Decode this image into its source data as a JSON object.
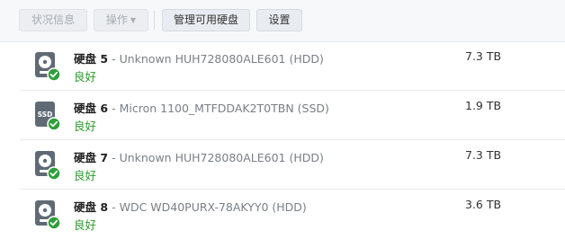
{
  "toolbar": {
    "status_info": "状况信息",
    "actions": "操作",
    "manage_drives": "管理可用硬盘",
    "settings": "设置"
  },
  "drives": [
    {
      "label": "硬盘 5",
      "model": "Unknown HUH728080ALE601 (HDD)",
      "status": "良好",
      "size": "7.3 TB",
      "type": "hdd"
    },
    {
      "label": "硬盘 6",
      "model": "Micron 1100_MTFDDAK2T0TBN (SSD)",
      "status": "良好",
      "size": "1.9 TB",
      "type": "ssd",
      "icon_text": "SSD"
    },
    {
      "label": "硬盘 7",
      "model": "Unknown HUH728080ALE601 (HDD)",
      "status": "良好",
      "size": "7.3 TB",
      "type": "hdd"
    },
    {
      "label": "硬盘 8",
      "model": "WDC WD40PURX-78AKYY0 (HDD)",
      "status": "良好",
      "size": "3.6 TB",
      "type": "hdd"
    }
  ],
  "colors": {
    "status_good": "#2a9a2a",
    "badge": "#2e9f3a",
    "drive_icon": "#5f6a75"
  }
}
